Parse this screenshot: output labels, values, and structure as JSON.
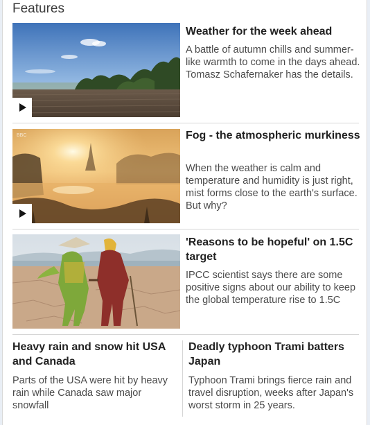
{
  "section": {
    "title": "Features"
  },
  "items": [
    {
      "title": "Weather for the week ahead",
      "summary": "A battle of autumn chills and summer-like warmth to come in the days ahead. Tomasz Schafernaker has the details.",
      "video": true
    },
    {
      "title": "Fog - the atmospheric murkiness",
      "summary": "When the weather is calm and temperature and humidity is just right, mist forms close to the earth's surface. But why?",
      "video": true
    },
    {
      "title": "'Reasons to be hopeful' on 1.5C target",
      "summary": "IPCC scientist says there are some positive signs about our ability to keep the global temperature rise to 1.5C",
      "video": false
    }
  ],
  "bottom": [
    {
      "title": "Heavy rain and snow hit USA and Canada",
      "summary": "Parts of the USA were hit by heavy rain while Canada saw major snowfall"
    },
    {
      "title": "Deadly typhoon Trami batters Japan",
      "summary": "Typhoon Trami brings fierce rain and travel disruption, weeks after Japan's worst storm in 25 years."
    }
  ]
}
